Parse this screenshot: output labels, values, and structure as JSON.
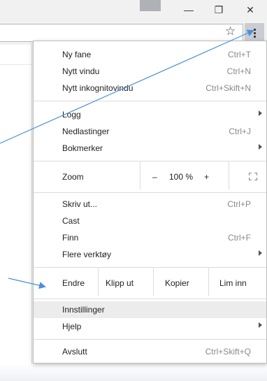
{
  "window": {
    "minimize_icon": "minimize-icon",
    "restore_icon": "restore-icon",
    "close_icon": "close-icon",
    "minimize_glyph": "—",
    "restore_glyph": "❐",
    "close_glyph": "✕"
  },
  "toolbar": {
    "star_glyph": "☆",
    "star_icon": "bookmark-star-icon",
    "menu_icon": "chrome-menu-icon"
  },
  "menu": {
    "section1": [
      {
        "label": "Ny fane",
        "shortcut": "Ctrl+T"
      },
      {
        "label": "Nytt vindu",
        "shortcut": "Ctrl+N"
      },
      {
        "label": "Nytt inkognitovindu",
        "shortcut": "Ctrl+Skift+N"
      }
    ],
    "section2": [
      {
        "label": "Logg",
        "shortcut": "",
        "submenu": true
      },
      {
        "label": "Nedlastinger",
        "shortcut": "Ctrl+J"
      },
      {
        "label": "Bokmerker",
        "shortcut": "",
        "submenu": true
      }
    ],
    "zoom": {
      "label": "Zoom",
      "minus": "–",
      "value": "100 %",
      "plus": "+",
      "fullscreen_icon": "fullscreen-icon"
    },
    "section4": [
      {
        "label": "Skriv ut...",
        "shortcut": "Ctrl+P"
      },
      {
        "label": "Cast",
        "shortcut": ""
      },
      {
        "label": "Finn",
        "shortcut": "Ctrl+F"
      },
      {
        "label": "Flere verktøy",
        "shortcut": "",
        "submenu": true
      }
    ],
    "edit": {
      "label": "Endre",
      "cut": "Klipp ut",
      "copy": "Kopier",
      "paste": "Lim inn"
    },
    "section6": [
      {
        "label": "Innstillinger",
        "shortcut": "",
        "highlighted": true
      },
      {
        "label": "Hjelp",
        "shortcut": "",
        "submenu": true
      }
    ],
    "section7": [
      {
        "label": "Avslutt",
        "shortcut": "Ctrl+Skift+Q"
      }
    ]
  },
  "annotation": {
    "arrow_color": "#4a90d9"
  }
}
